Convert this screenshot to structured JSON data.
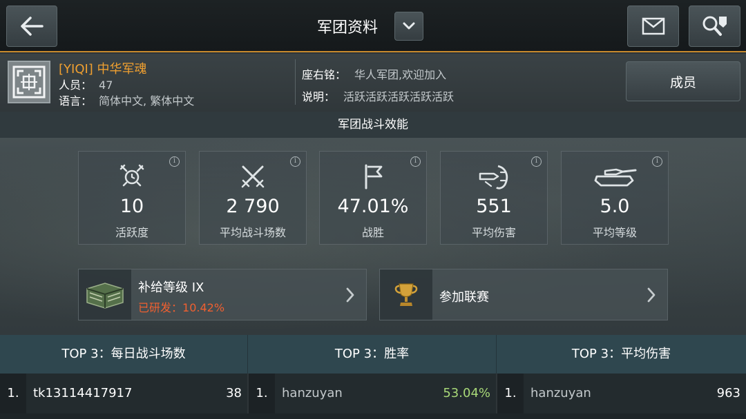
{
  "header": {
    "title": "军团资料",
    "back_icon": "arrow-left-icon",
    "dropdown_icon": "chevron-down-icon",
    "mail_icon": "envelope-icon",
    "search_icon": "search-clan-icon"
  },
  "clan": {
    "tag_name": "[YIQI] 中华军魂",
    "members_label": "人员：",
    "members_value": "47",
    "language_label": "语言：",
    "language_value": "简体中文, 繁体中文",
    "motto_label": "座右铭：",
    "motto_value": "华人军团,欢迎加入",
    "desc_label": "说明：",
    "desc_value": "活跃活跃活跃活跃活跃",
    "members_button": "成员"
  },
  "performance": {
    "title": "军团战斗效能",
    "stats": [
      {
        "value": "10",
        "label": "活跃度",
        "icon": "alarm-clock-swords-icon"
      },
      {
        "value": "2 790",
        "label": "平均战斗场数",
        "icon": "crossed-swords-icon"
      },
      {
        "value": "47.01%",
        "label": "战胜",
        "icon": "flag-icon"
      },
      {
        "value": "551",
        "label": "平均伤害",
        "icon": "shell-impact-icon"
      },
      {
        "value": "5.0",
        "label": "平均等级",
        "icon": "tank-icon"
      }
    ]
  },
  "supply": {
    "title": "补给等级 IX",
    "progress_label": "已研发：",
    "progress_value": "10.42%"
  },
  "league": {
    "title": "参加联赛"
  },
  "top3": [
    {
      "header": "TOP 3：每日战斗场数",
      "rank": "1.",
      "name": "tk13114417917",
      "value": "38"
    },
    {
      "header": "TOP 3：胜率",
      "rank": "1.",
      "name": "hanzuyan",
      "value": "53.04%"
    },
    {
      "header": "TOP 3：平均伤害",
      "rank": "1.",
      "name": "hanzuyan",
      "value": "963"
    }
  ],
  "colors": {
    "accent_orange": "#c98a2c",
    "clan_name": "#f0a030",
    "supply_progress": "#f06030",
    "winrate_green": "#a8d878"
  }
}
